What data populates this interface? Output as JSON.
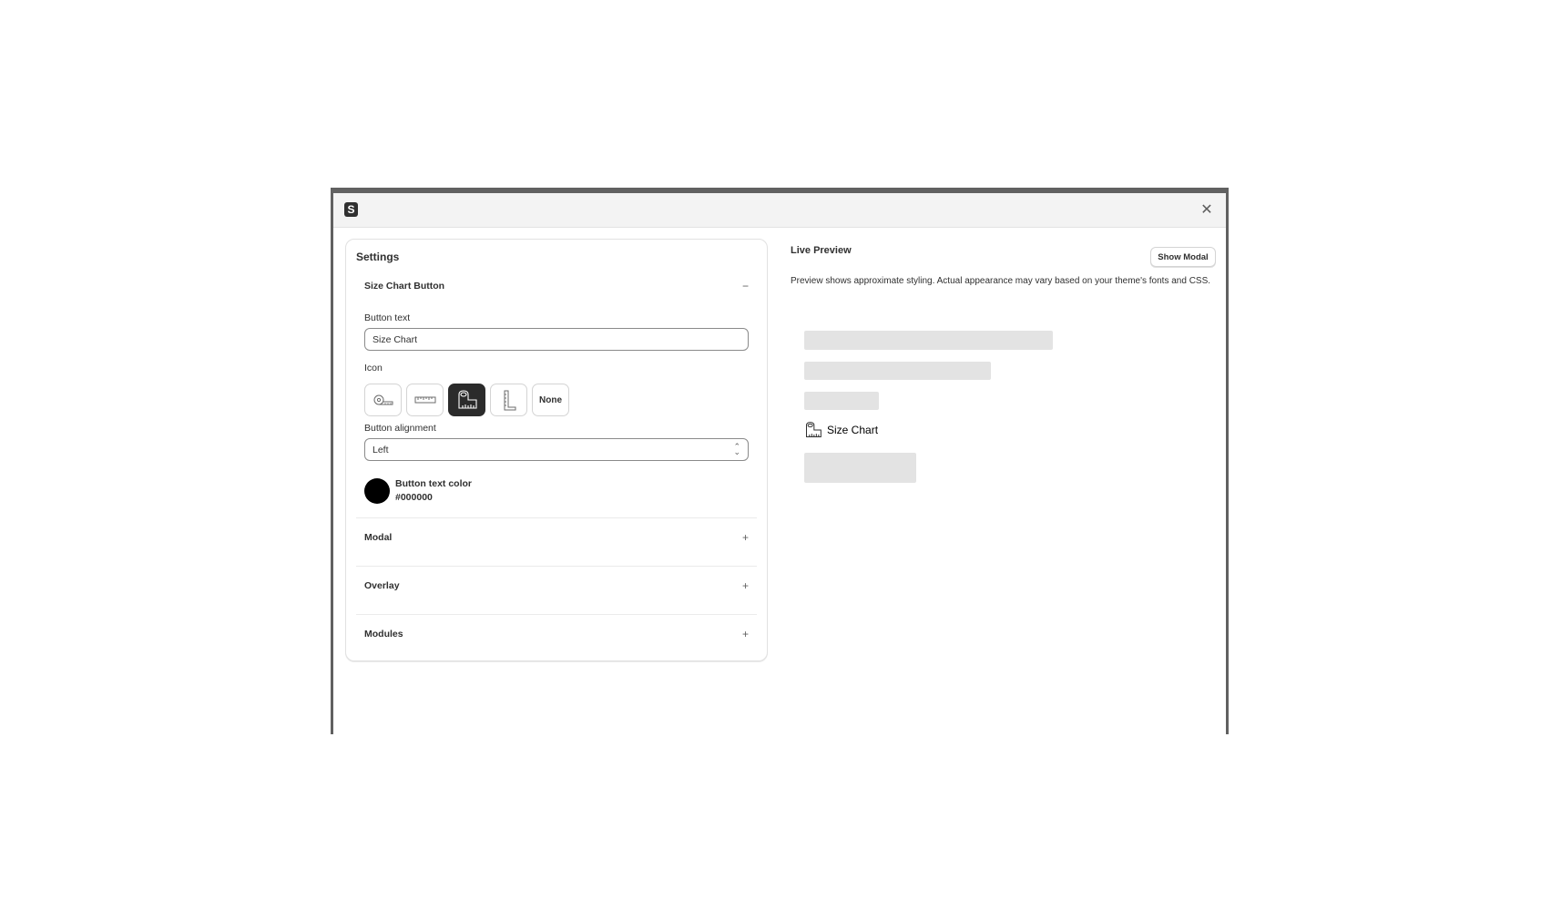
{
  "app": {
    "logo_letter": "S",
    "close_icon": "✕"
  },
  "settings": {
    "title": "Settings",
    "size_chart_section": {
      "label": "Size Chart Button",
      "toggle": "−",
      "button_text_label": "Button text",
      "button_text_value": "Size Chart",
      "icon_label": "Icon",
      "icon_options": [
        "tape-measure-icon",
        "ruler-icon",
        "tape-measure-box-icon",
        "ruler-vertical-icon",
        "None"
      ],
      "icon_none_label": "None",
      "selected_icon": "tape-measure-box-icon",
      "alignment_label": "Button alignment",
      "alignment_value": "Left",
      "color_label": "Button text color",
      "color_value": "#000000"
    },
    "sections": [
      {
        "label": "Modal",
        "toggle": "+"
      },
      {
        "label": "Overlay",
        "toggle": "+"
      },
      {
        "label": "Modules",
        "toggle": "+"
      }
    ]
  },
  "preview": {
    "title": "Live Preview",
    "show_modal_label": "Show Modal",
    "note": "Preview shows approximate styling. Actual appearance may vary based on your theme's fonts and CSS.",
    "button_label": "Size Chart",
    "button_icon": "tape-measure-box-icon"
  },
  "colors": {
    "selected_icon_bg": "#2b2b2b",
    "skeleton": "#e3e3e3",
    "text_color": "#000000"
  }
}
